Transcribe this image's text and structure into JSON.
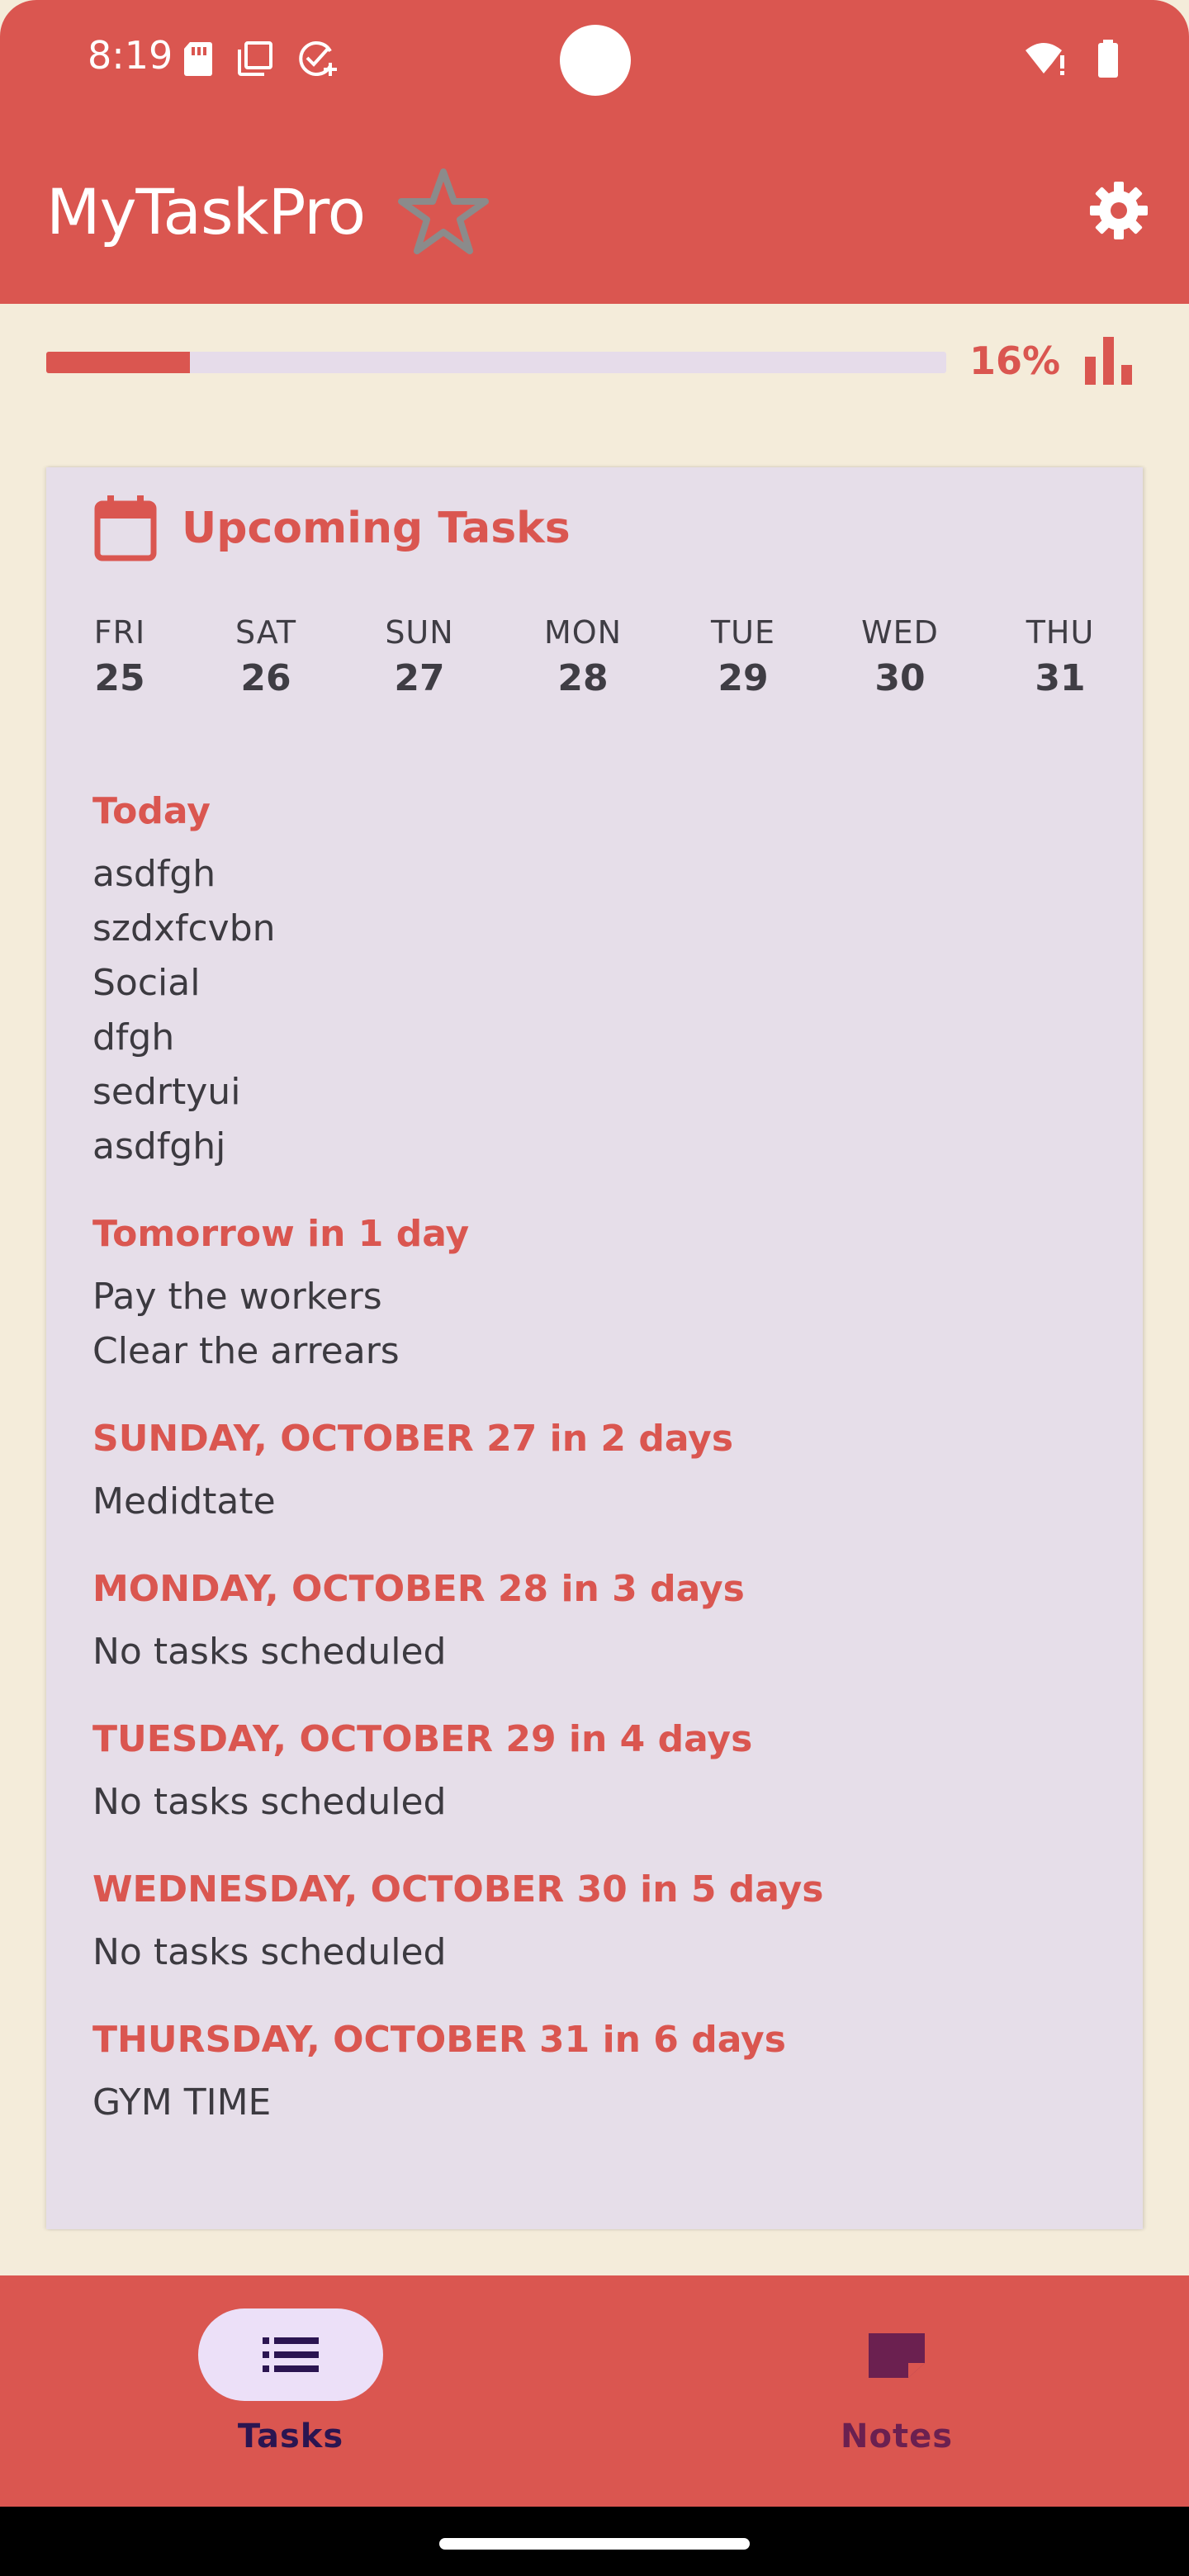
{
  "status_bar": {
    "time": "8:19",
    "icons_left": [
      "sd-card-icon",
      "screenshot-icon",
      "task-check-icon"
    ],
    "icons_right": [
      "wifi-alert-icon",
      "battery-icon"
    ]
  },
  "app_bar": {
    "title": "MyTaskPro",
    "star_icon": "star-outline-icon",
    "settings_icon": "gear-icon"
  },
  "progress": {
    "percent": 16,
    "label": "16%",
    "stats_icon": "bar-chart-icon"
  },
  "upcoming": {
    "title": "Upcoming Tasks",
    "days": [
      {
        "name": "FRI",
        "num": "25"
      },
      {
        "name": "SAT",
        "num": "26"
      },
      {
        "name": "SUN",
        "num": "27"
      },
      {
        "name": "MON",
        "num": "28"
      },
      {
        "name": "TUE",
        "num": "29"
      },
      {
        "name": "WED",
        "num": "30"
      },
      {
        "name": "THU",
        "num": "31"
      }
    ],
    "sections": [
      {
        "heading": "Today",
        "tasks": [
          "asdfgh",
          "szdxfcvbn",
          "Social",
          "dfgh",
          "sedrtyui",
          "asdfghj"
        ]
      },
      {
        "heading": "Tomorrow in 1 day",
        "tasks": [
          "Pay the workers",
          "Clear the arrears"
        ]
      },
      {
        "heading": "SUNDAY, OCTOBER 27 in 2 days",
        "tasks": [
          "Medidtate"
        ]
      },
      {
        "heading": "MONDAY, OCTOBER 28 in 3 days",
        "tasks": [
          "No tasks scheduled"
        ]
      },
      {
        "heading": "TUESDAY, OCTOBER 29 in 4 days",
        "tasks": [
          "No tasks scheduled"
        ]
      },
      {
        "heading": "WEDNESDAY, OCTOBER 30 in 5 days",
        "tasks": [
          "No tasks scheduled"
        ]
      },
      {
        "heading": "THURSDAY, OCTOBER 31 in 6 days",
        "tasks": [
          "GYM TIME"
        ]
      }
    ]
  },
  "bottom_nav": {
    "tasks_label": "Tasks",
    "notes_label": "Notes"
  },
  "colors": {
    "accent": "#da5650",
    "background": "#f4ecda",
    "card": "#e6dee9",
    "nav_active_pill": "#ece0f8",
    "nav_active_text": "#2b1551",
    "nav_inactive": "#6b2050"
  }
}
